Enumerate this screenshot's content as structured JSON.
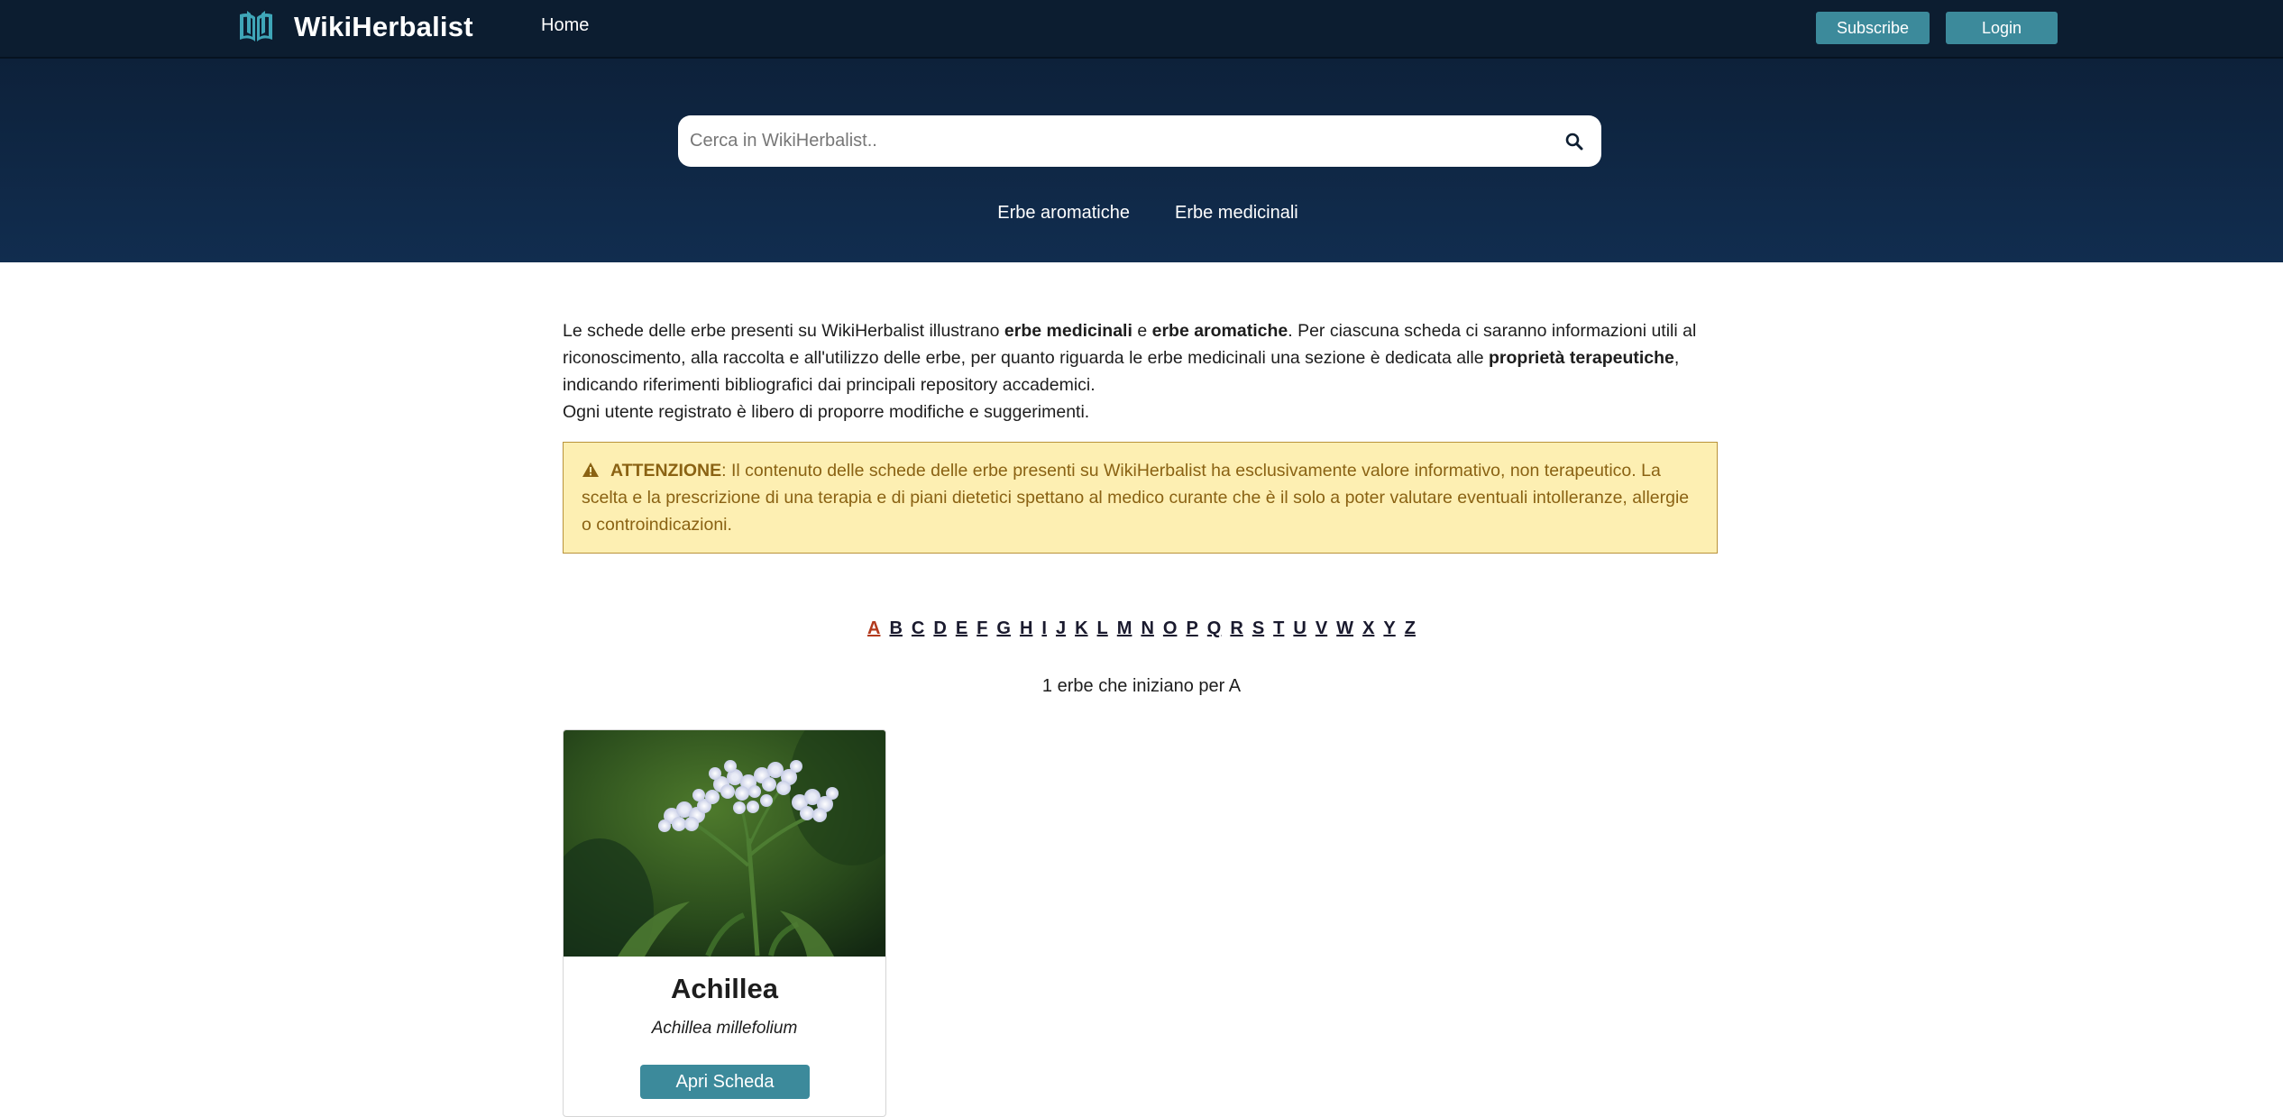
{
  "navbar": {
    "brand": "WikiHerbalist",
    "home": "Home",
    "subscribe": "Subscribe",
    "login": "Login"
  },
  "search": {
    "placeholder": "Cerca in WikiHerbalist.."
  },
  "categories": [
    "Erbe aromatiche",
    "Erbe medicinali"
  ],
  "intro": {
    "p1_a": "Le schede delle erbe presenti su WikiHerbalist illustrano ",
    "p1_b": "erbe medicinali",
    "p1_c": " e ",
    "p1_d": "erbe aromatiche",
    "p1_e": ". Per ciascuna scheda ci saranno informazioni utili al riconoscimento, alla raccolta e all'utilizzo delle erbe, per quanto riguarda le erbe medicinali una sezione è dedicata alle ",
    "p1_f": "proprietà terapeutiche",
    "p1_g": ", indicando riferimenti bibliografici dai principali repository accademici.",
    "p2": "Ogni utente registrato è libero di proporre modifiche e suggerimenti."
  },
  "alert": {
    "title": "ATTENZIONE",
    "text": ": Il contenuto delle schede delle erbe presenti su WikiHerbalist ha esclusivamente valore informativo, non terapeutico. La scelta e la prescrizione di una terapia e di piani dietetici spettano al medico curante che è il solo a poter valutare eventuali intolleranze, allergie o controindicazioni."
  },
  "alphabet": {
    "letters": [
      "A",
      "B",
      "C",
      "D",
      "E",
      "F",
      "G",
      "H",
      "I",
      "J",
      "K",
      "L",
      "M",
      "N",
      "O",
      "P",
      "Q",
      "R",
      "S",
      "T",
      "U",
      "V",
      "W",
      "X",
      "Y",
      "Z"
    ],
    "active": "A"
  },
  "results": {
    "count_text": "1 erbe che iniziano per A"
  },
  "herbs": [
    {
      "name": "Achillea",
      "latin": "Achillea millefolium",
      "button": "Apri Scheda"
    }
  ],
  "colors": {
    "navbar": "#0c1d30",
    "hero_top": "#0d213a",
    "hero_bottom": "#112d4f",
    "accent_button": "#3c8a9b",
    "alert_bg": "#fdefb2",
    "alert_text": "#8a6213",
    "active_letter": "#b23a1d"
  }
}
